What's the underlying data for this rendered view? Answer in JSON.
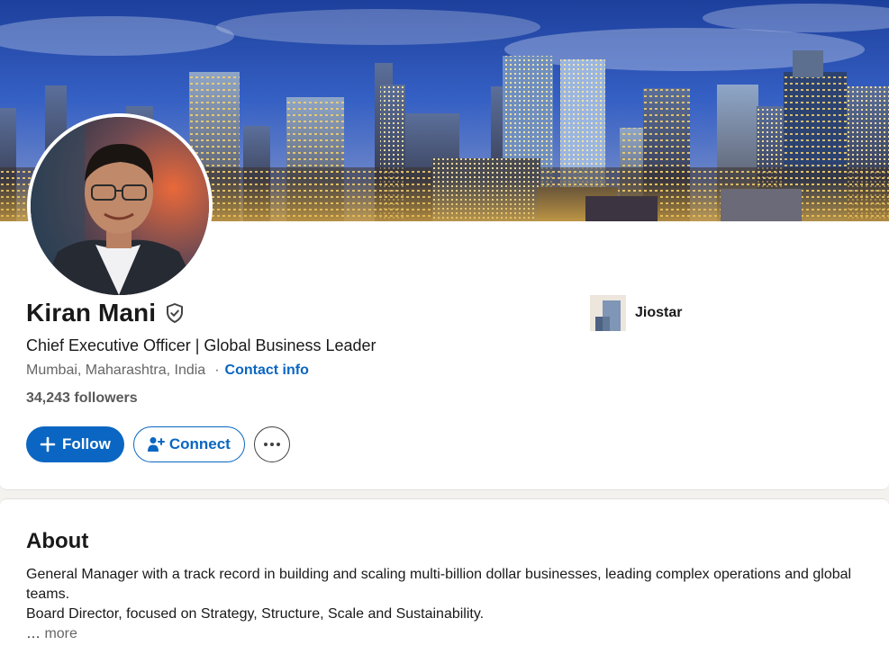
{
  "profile": {
    "name": "Kiran Mani",
    "headline": "Chief Executive Officer | Global Business Leader",
    "location": "Mumbai, Maharashtra, India",
    "separator": "·",
    "contact_label": "Contact info",
    "followers": "34,243 followers",
    "verified_icon": "shield-check-icon"
  },
  "actions": {
    "follow_label": "Follow",
    "connect_label": "Connect",
    "more_icon": "ellipsis-icon"
  },
  "company": {
    "name": "Jiostar"
  },
  "about": {
    "title": "About",
    "lines": [
      "General Manager with a track record in building and scaling multi-billion dollar businesses, leading complex operations and global teams.",
      "Board Director, focused on Strategy, Structure, Scale and Sustainability."
    ],
    "ellipsis": "…",
    "more_label": "more"
  },
  "colors": {
    "brand_blue": "#0a66c2",
    "page_bg": "#f4f2ee",
    "muted_text": "#666666"
  }
}
